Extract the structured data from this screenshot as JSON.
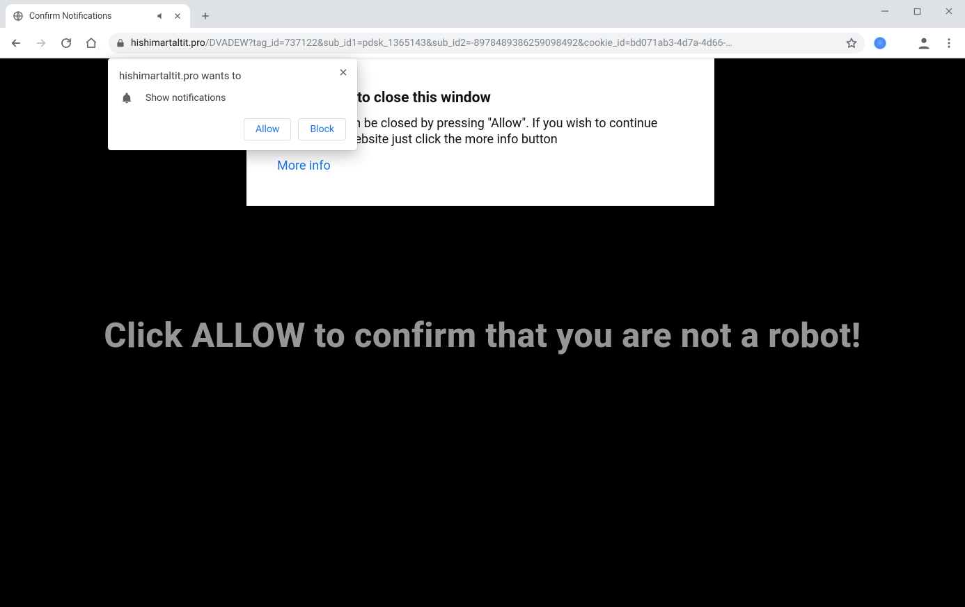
{
  "tab": {
    "title": "Confirm Notifications"
  },
  "addressbar": {
    "host": "hishimartaltit.pro",
    "path": "/DVADEW?tag_id=737122&sub_id1=pdsk_1365143&sub_id2=-8978489386259098492&cookie_id=bd071ab3-4d7a-4d66-…"
  },
  "page": {
    "box_heading": "Press \"Allow\" to close this window",
    "box_body": "This window can be closed by pressing \"Allow\". If you wish to continue browsing this website just click the more info button",
    "more_info": "More info",
    "big_text": "Click ALLOW to confirm that you are not a robot!"
  },
  "prompt": {
    "origin_line": "hishimartaltit.pro wants to",
    "permission_label": "Show notifications",
    "allow": "Allow",
    "block": "Block"
  }
}
